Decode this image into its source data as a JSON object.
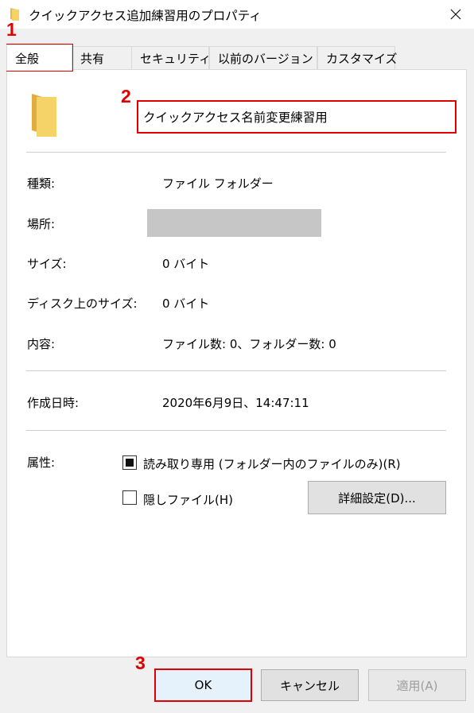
{
  "window": {
    "title": "クイックアクセス追加練習用のプロパティ"
  },
  "tabs": [
    {
      "label": "全般",
      "active": true
    },
    {
      "label": "共有"
    },
    {
      "label": "セキュリティ"
    },
    {
      "label": "以前のバージョン"
    },
    {
      "label": "カスタマイズ"
    }
  ],
  "general": {
    "folder_name": "クイックアクセス名前変更練習用",
    "rows": {
      "type": {
        "label": "種類:",
        "value": "ファイル フォルダー"
      },
      "location": {
        "label": "場所:"
      },
      "size": {
        "label": "サイズ:",
        "value": "0 バイト"
      },
      "disk_size": {
        "label": "ディスク上のサイズ:",
        "value": "0 バイト"
      },
      "contents": {
        "label": "内容:",
        "value": "ファイル数: 0、フォルダー数: 0"
      },
      "created": {
        "label": "作成日時:",
        "value": "2020年6月9日、14:47:11"
      }
    },
    "attributes": {
      "label": "属性:",
      "readonly": {
        "label": "読み取り専用 (フォルダー内のファイルのみ)(R)",
        "state": "indeterminate"
      },
      "hidden": {
        "label": "隠しファイル(H)",
        "checked": false
      },
      "advanced_button": "詳細設定(D)..."
    }
  },
  "buttons": {
    "ok": "OK",
    "cancel": "キャンセル",
    "apply": "適用(A)"
  },
  "annotations": {
    "step1": "1",
    "step2": "2",
    "step3": "3"
  },
  "colors": {
    "highlight": "#e00000",
    "folder": "#f6d367"
  }
}
